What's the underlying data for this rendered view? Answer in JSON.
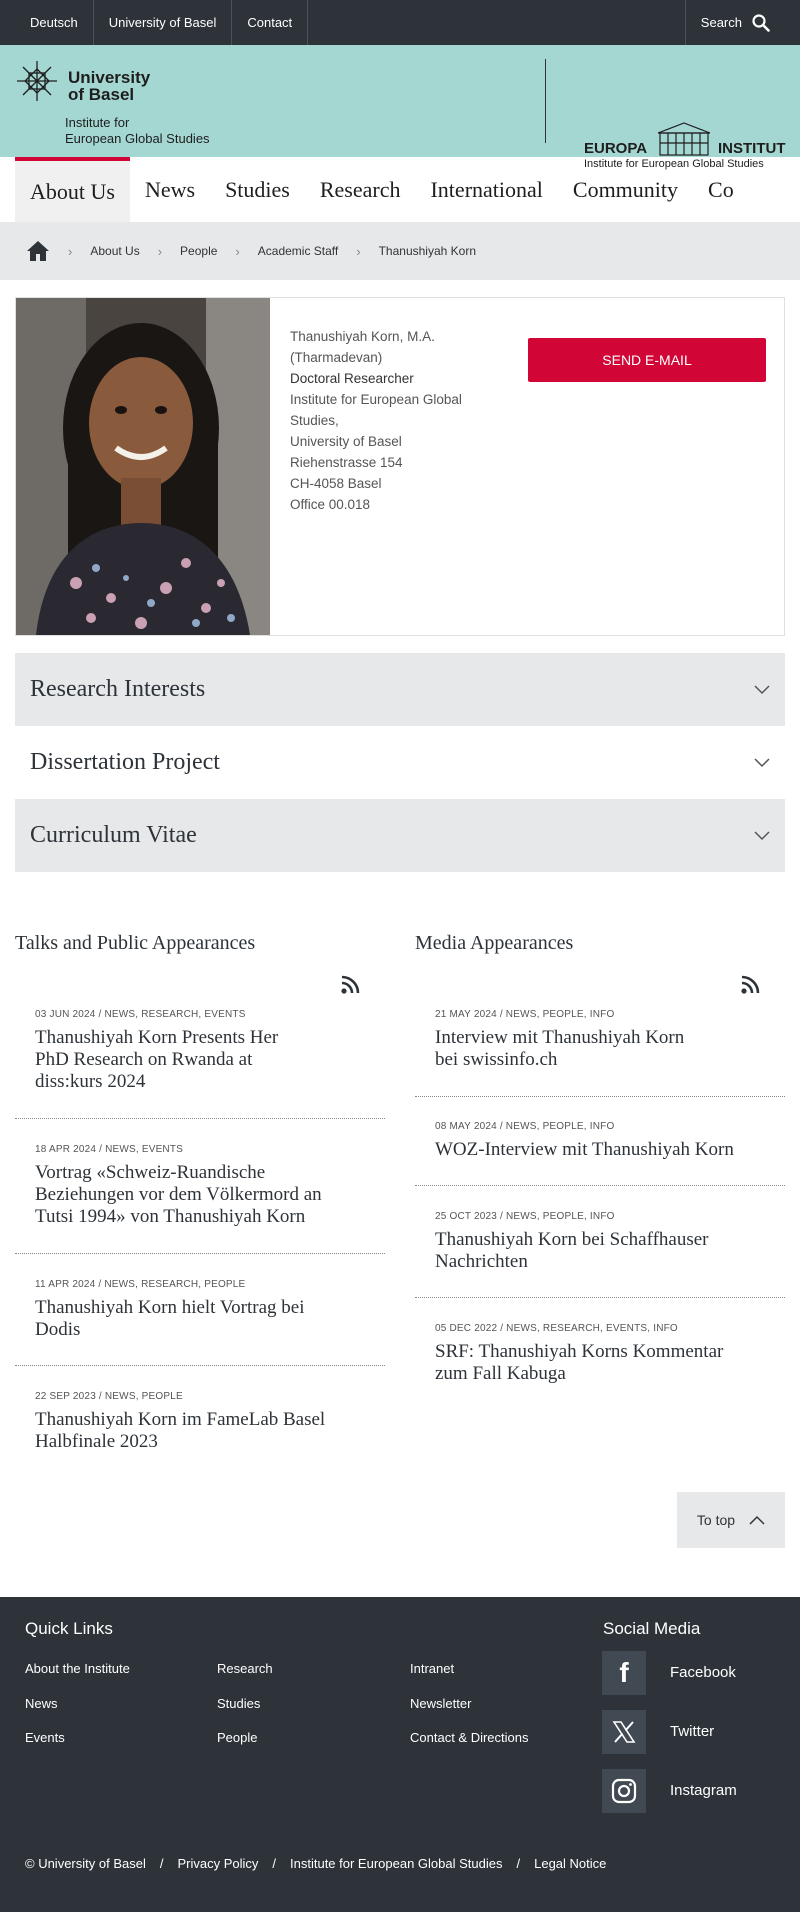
{
  "topbar": {
    "links": [
      "Deutsch",
      "University of Basel",
      "Contact"
    ],
    "search_label": "Search"
  },
  "header": {
    "uni_name_line1": "University",
    "uni_name_line2": "of Basel",
    "institute_line1": "Institute for",
    "institute_line2": "European Global Studies",
    "europa_left": "EUROPA",
    "europa_right": "INSTITUT",
    "europa_sub": "Institute for European Global Studies"
  },
  "nav": {
    "items": [
      "About Us",
      "News",
      "Studies",
      "Research",
      "International",
      "Community",
      "Co"
    ],
    "active": "About Us"
  },
  "breadcrumb": [
    "About Us",
    "People",
    "Academic Staff",
    "Thanushiyah Korn"
  ],
  "profile": {
    "name": "Thanushiyah Korn, M.A.",
    "name_note": "(Tharmadevan)",
    "role": "Doctoral Researcher",
    "address": [
      "Institute for European Global",
      "Studies,",
      "University of Basel",
      "Riehenstrasse 154",
      "CH-4058 Basel",
      "Office 00.018"
    ],
    "email_button": "SEND E-MAIL"
  },
  "accordions": [
    "Research Interests",
    "Dissertation Project",
    "Curriculum Vitae"
  ],
  "talks": {
    "title": "Talks and Public Appearances",
    "items": [
      {
        "meta": "03 JUN 2024 / NEWS, RESEARCH, EVENTS",
        "title_lines": [
          "Thanushiyah Korn Presents Her",
          "PhD Research on Rwanda at",
          "diss:kurs 2024"
        ]
      },
      {
        "meta": "18 APR 2024 / NEWS, EVENTS",
        "title_lines": [
          "Vortrag «Schweiz-Ruandische",
          "Beziehungen vor dem Völkermord an",
          "Tutsi 1994» von Thanushiyah Korn"
        ]
      },
      {
        "meta": "11 APR 2024 / NEWS, RESEARCH, PEOPLE",
        "title_lines": [
          "Thanushiyah Korn hielt Vortrag bei",
          "Dodis"
        ]
      },
      {
        "meta": "22 SEP 2023 / NEWS, PEOPLE",
        "title_lines": [
          "Thanushiyah Korn im FameLab Basel",
          "Halbfinale 2023"
        ]
      }
    ]
  },
  "media": {
    "title": "Media Appearances",
    "items": [
      {
        "meta": "21 MAY 2024 / NEWS, PEOPLE, INFO",
        "title_lines": [
          "Interview mit Thanushiyah Korn",
          "bei swissinfo.ch"
        ]
      },
      {
        "meta": "08 MAY 2024 / NEWS, PEOPLE, INFO",
        "title_lines": [
          "WOZ-Interview mit Thanushiyah Korn"
        ]
      },
      {
        "meta": "25 OCT 2023 / NEWS, PEOPLE, INFO",
        "title_lines": [
          "Thanushiyah Korn bei Schaffhauser",
          "Nachrichten"
        ]
      },
      {
        "meta": "05 DEC 2022 / NEWS, RESEARCH, EVENTS, INFO",
        "title_lines": [
          "SRF: Thanushiyah Korns Kommentar",
          "zum Fall Kabuga"
        ]
      }
    ]
  },
  "to_top": "To top",
  "footer": {
    "quick_links_title": "Quick Links",
    "quick_links": [
      [
        "About the Institute",
        "News",
        "Events"
      ],
      [
        "Research",
        "Studies",
        "People"
      ],
      [
        "Intranet",
        "Newsletter",
        "Contact & Directions"
      ]
    ],
    "social_title": "Social Media",
    "social": [
      "Facebook",
      "Twitter",
      "Instagram"
    ],
    "legal": [
      "© University of Basel",
      "/",
      "Privacy Policy",
      "/",
      "Institute for European Global Studies",
      "/",
      "Legal Notice"
    ]
  },
  "colors": {
    "accent": "#d20537",
    "header_band": "#a5d7d2",
    "dark": "#2d3339",
    "grey": "#e6e8ea"
  }
}
